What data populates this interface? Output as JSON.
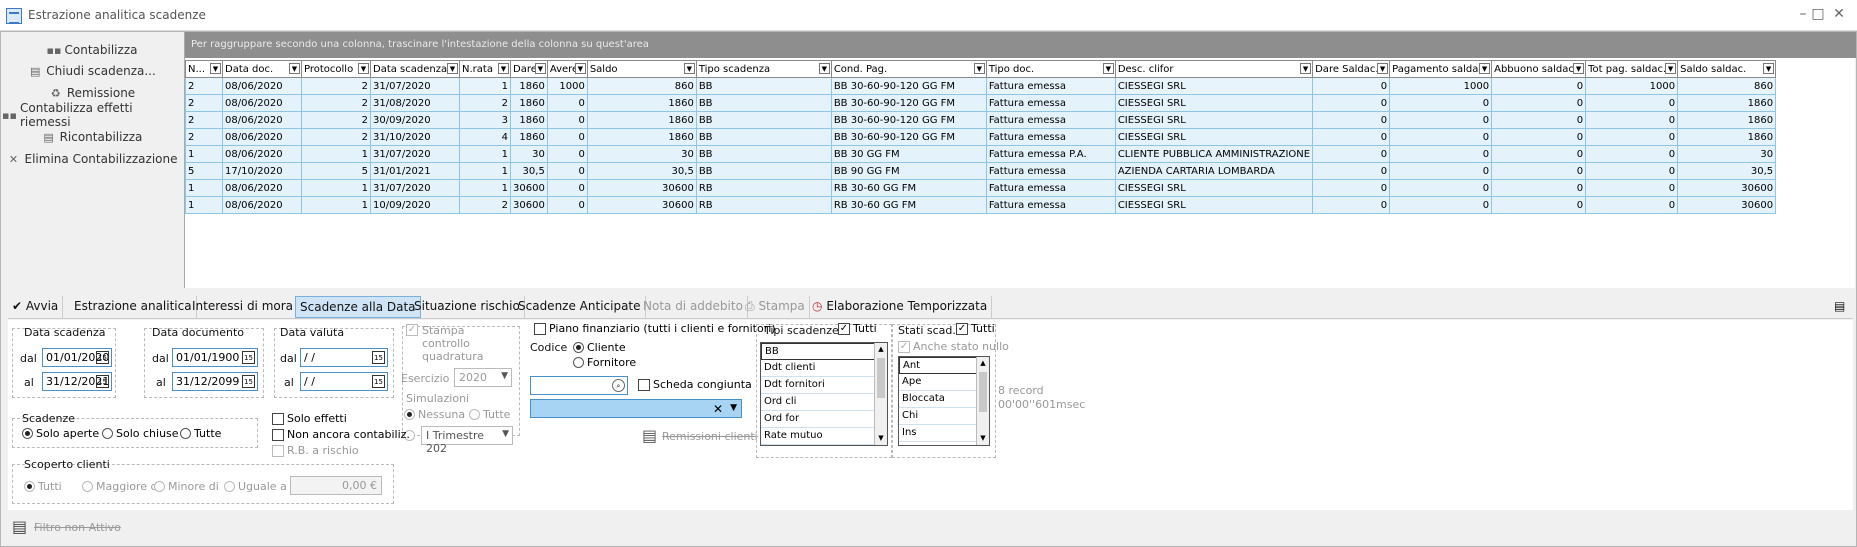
{
  "window": {
    "title": "Estrazione analitica scadenze"
  },
  "nav": [
    {
      "label": "Contabilizza",
      "icon": "post-icon"
    },
    {
      "label": "Chiudi scadenza...",
      "icon": "document-icon"
    },
    {
      "label": "Remissione",
      "icon": "recycle-icon"
    },
    {
      "label": "Contabilizza effetti riemessi",
      "icon": "post-icon"
    },
    {
      "label": "Ricontabilizza",
      "icon": "document-icon"
    },
    {
      "label": "Elimina Contabilizzazione",
      "icon": "delete-icon"
    }
  ],
  "grid": {
    "group_hint": "Per raggruppare secondo una colonna, trascinare l'intestazione della colonna su quest'area",
    "columns": [
      "N...",
      "Data doc.",
      "Protocollo",
      "Data scadenza",
      "N.rata",
      "Dare",
      "Avere",
      "Saldo",
      "Tipo scadenza",
      "Cond. Pag.",
      "Tipo doc.",
      "Desc. clifor",
      "Dare Saldac.",
      "Pagamento saldac.",
      "Abbuono saldac.",
      "Tot pag. saldac.",
      "Saldo saldac."
    ],
    "rows": [
      [
        "2",
        "08/06/2020",
        "2",
        "31/07/2020",
        "1",
        "1860",
        "1000",
        "860",
        "BB",
        "BB 30-60-90-120 GG FM",
        "Fattura emessa",
        "CIESSEGI SRL",
        "0",
        "1000",
        "0",
        "1000",
        "860"
      ],
      [
        "2",
        "08/06/2020",
        "2",
        "31/08/2020",
        "2",
        "1860",
        "0",
        "1860",
        "BB",
        "BB 30-60-90-120 GG FM",
        "Fattura emessa",
        "CIESSEGI SRL",
        "0",
        "0",
        "0",
        "0",
        "1860"
      ],
      [
        "2",
        "08/06/2020",
        "2",
        "30/09/2020",
        "3",
        "1860",
        "0",
        "1860",
        "BB",
        "BB 30-60-90-120 GG FM",
        "Fattura emessa",
        "CIESSEGI SRL",
        "0",
        "0",
        "0",
        "0",
        "1860"
      ],
      [
        "2",
        "08/06/2020",
        "2",
        "31/10/2020",
        "4",
        "1860",
        "0",
        "1860",
        "BB",
        "BB 30-60-90-120 GG FM",
        "Fattura emessa",
        "CIESSEGI SRL",
        "0",
        "0",
        "0",
        "0",
        "1860"
      ],
      [
        "1",
        "08/06/2020",
        "1",
        "31/07/2020",
        "1",
        "30",
        "0",
        "30",
        "BB",
        "BB 30 GG FM",
        "Fattura emessa P.A.",
        "CLIENTE PUBBLICA AMMINISTRAZIONE",
        "0",
        "0",
        "0",
        "0",
        "30"
      ],
      [
        "5",
        "17/10/2020",
        "5",
        "31/01/2021",
        "1",
        "30,5",
        "0",
        "30,5",
        "BB",
        "BB 90 GG FM",
        "Fattura emessa",
        "AZIENDA CARTARIA LOMBARDA",
        "0",
        "0",
        "0",
        "0",
        "30,5"
      ],
      [
        "1",
        "08/06/2020",
        "1",
        "31/07/2020",
        "1",
        "30600",
        "0",
        "30600",
        "RB",
        "RB 30-60 GG FM",
        "Fattura emessa",
        "CIESSEGI SRL",
        "0",
        "0",
        "0",
        "0",
        "30600"
      ],
      [
        "1",
        "08/06/2020",
        "1",
        "10/09/2020",
        "2",
        "30600",
        "0",
        "30600",
        "RB",
        "RB 30-60 GG FM",
        "Fattura emessa",
        "CIESSEGI SRL",
        "0",
        "0",
        "0",
        "0",
        "30600"
      ]
    ]
  },
  "tabs": [
    {
      "label": "Avvia",
      "active": false,
      "disabled": false
    },
    {
      "label": "Estrazione analitica",
      "active": false,
      "disabled": false
    },
    {
      "label": "Interessi di mora",
      "active": false,
      "disabled": false
    },
    {
      "label": "Scadenze alla Data",
      "active": true,
      "disabled": false
    },
    {
      "label": "Situazione rischio",
      "active": false,
      "disabled": false
    },
    {
      "label": "Scadenze Anticipate",
      "active": false,
      "disabled": false
    },
    {
      "label": "Nota di addebito",
      "active": false,
      "disabled": true
    },
    {
      "label": "Stampa",
      "active": false,
      "disabled": true
    },
    {
      "label": "Elaborazione Temporizzata",
      "active": false,
      "disabled": false
    }
  ],
  "filters": {
    "data_scadenza": {
      "title": "Data scadenza",
      "dal_label": "dal",
      "al_label": "al",
      "dal": "01/01/2020",
      "al": "31/12/2021"
    },
    "data_documento": {
      "title": "Data documento",
      "dal_label": "dal",
      "al_label": "al",
      "dal": "01/01/1900",
      "al": "31/12/2099"
    },
    "data_valuta": {
      "title": "Data valuta",
      "dal_label": "dal",
      "al_label": "al",
      "dal": " / /",
      "al": " / /"
    },
    "stampa_controllo": "Stampa controllo quadratura",
    "esercizio_label": "Esercizio",
    "esercizio": "2020",
    "simulazioni_label": "Simulazioni",
    "sim_nessuna": "Nessuna",
    "sim_tutte": "Tutte",
    "trimestre": "I Trimestre 202",
    "piano_finanziario": "Piano finanziario (tutti i clienti e fornitori)",
    "codice_label": "Codice",
    "cliente": "Cliente",
    "fornitore": "Fornitore",
    "scheda_congiunta": "Scheda congiunta",
    "remissioni_clienti": "Remissioni clienti",
    "scadenze": {
      "title": "Scadenze",
      "solo_aperte": "Solo aperte",
      "solo_chiuse": "Solo chiuse",
      "tutte": "Tutte"
    },
    "solo_effetti": "Solo effetti",
    "non_contabiliz": "Non ancora contabiliz.",
    "rb_rischio": "R.B. a rischio",
    "scoperto": {
      "title": "Scoperto clienti",
      "tutti": "Tutti",
      "maggiore": "Maggiore di",
      "minore": "Minore di",
      "uguale": "Uguale a",
      "importo": "0,00 €"
    },
    "tipi_scadenze": {
      "title": "Tipi scadenze",
      "tutti": "Tutti",
      "items": [
        "BB",
        "Ddt clienti",
        "Ddt fornitori",
        "Ord cli",
        "Ord for",
        "Rate mutuo"
      ]
    },
    "stati_scad": {
      "title": "Stati scad.",
      "tutti": "Tutti",
      "anche_nullo": "Anche stato nullo",
      "items": [
        "Ant",
        "Ape",
        "Bloccata",
        "Chi",
        "Ins"
      ]
    },
    "record_count": "8 record",
    "elapsed": "00'00''601msec"
  },
  "footer": {
    "filter_status": "Filtro non Attivo"
  },
  "colors": {
    "accent": "#4a90c8",
    "row_bg": "#e3f2fb",
    "group_bar": "#8e8e8e",
    "active_tab": "#cfe5f7"
  }
}
